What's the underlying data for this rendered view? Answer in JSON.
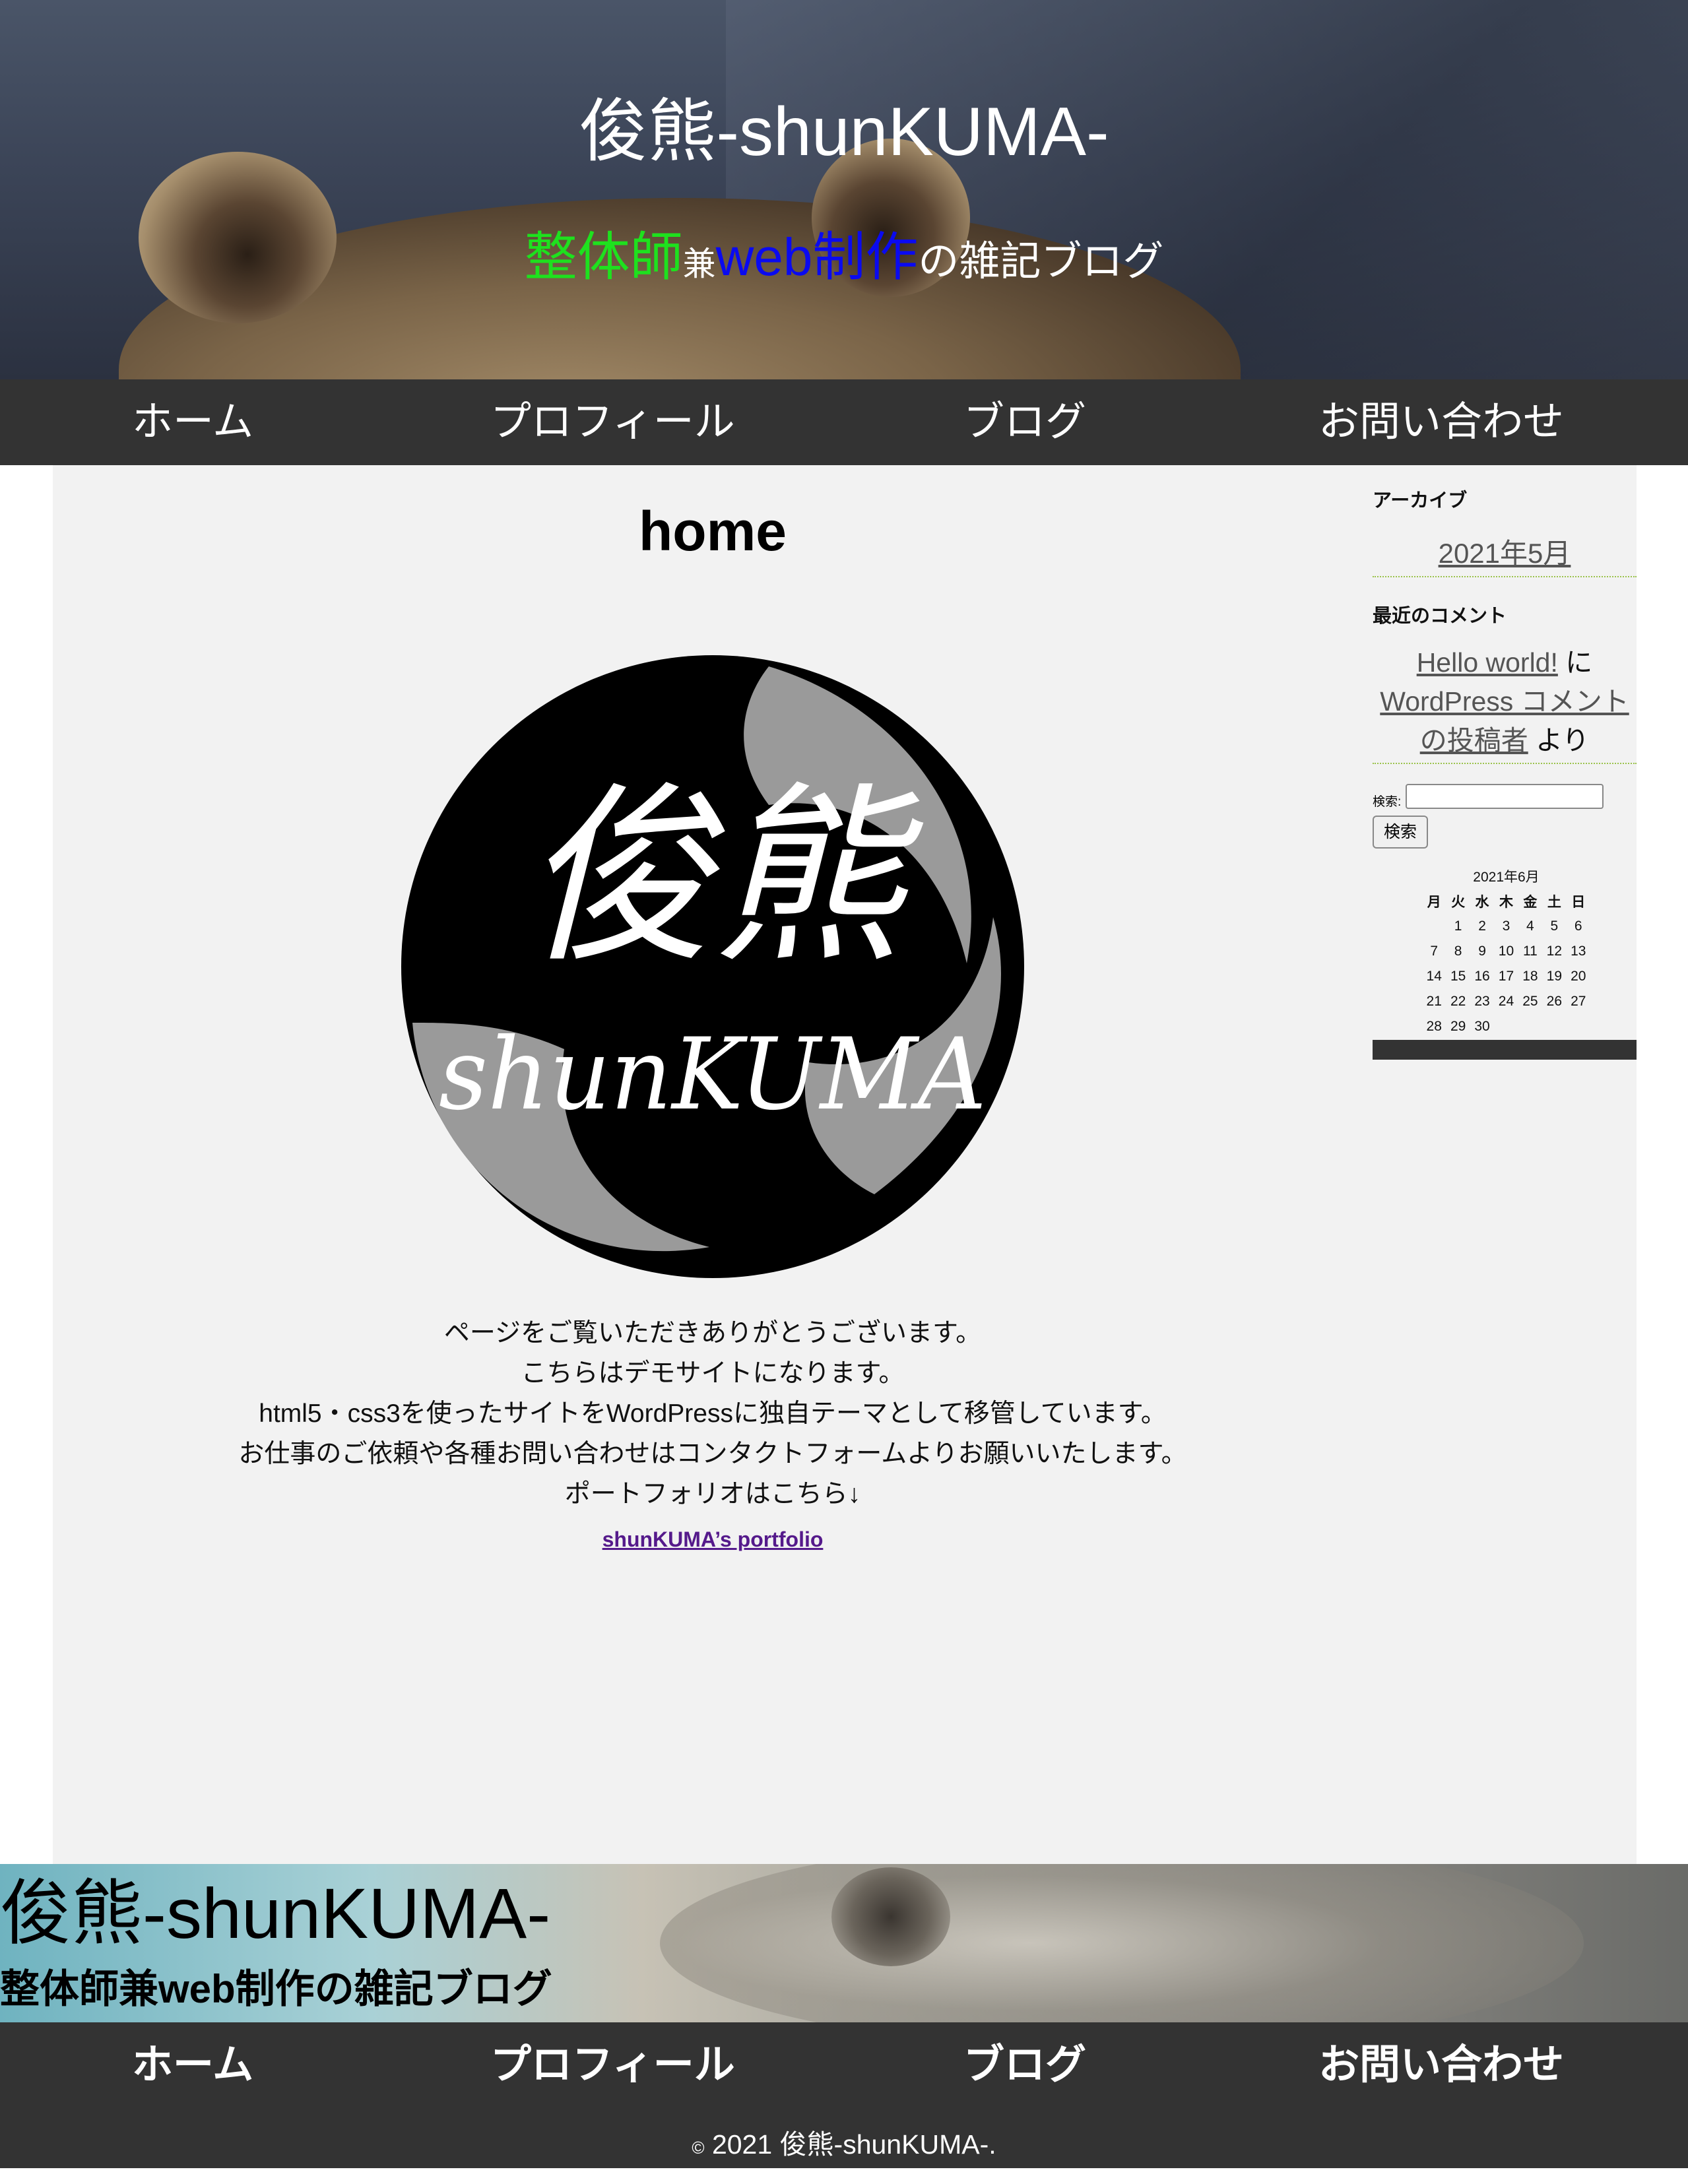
{
  "header": {
    "title": "俊熊-shunKUMA-",
    "subtitle": {
      "part1": "整体師",
      "part2": "兼",
      "part3": "web制作",
      "part4": "の雑記ブログ"
    }
  },
  "nav": {
    "items": [
      {
        "label": "ホーム"
      },
      {
        "label": "プロフィール"
      },
      {
        "label": "ブログ"
      },
      {
        "label": "お問い合わせ"
      }
    ]
  },
  "main": {
    "title": "home",
    "logo": {
      "kanji": "俊熊",
      "text": "shunKUMA"
    },
    "message": [
      "ページをご覧いただきありがとうございます。",
      "こちらはデモサイトになります。",
      "html5・css3を使ったサイトをWordPressに独自テーマとして移管しています。",
      "お仕事のご依頼や各種お問い合わせはコンタクトフォームよりお願いいたします。",
      "ポートフォリオはこちら↓"
    ],
    "portfolio_link": "shunKUMA’s portfolio"
  },
  "sidebar": {
    "archive": {
      "title": "アーカイブ",
      "link": "2021年5月"
    },
    "recent_comments": {
      "title": "最近のコメント",
      "post": "Hello world!",
      "ni": "に",
      "author": "WordPress コメントの投稿者",
      "yori": "より"
    },
    "search": {
      "label": "検索:",
      "button": "検索"
    },
    "calendar": {
      "caption": "2021年6月",
      "headers": [
        "月",
        "火",
        "水",
        "木",
        "金",
        "土",
        "日"
      ],
      "weeks": [
        [
          "",
          "1",
          "2",
          "3",
          "4",
          "5",
          "6"
        ],
        [
          "7",
          "8",
          "9",
          "10",
          "11",
          "12",
          "13"
        ],
        [
          "14",
          "15",
          "16",
          "17",
          "18",
          "19",
          "20"
        ],
        [
          "21",
          "22",
          "23",
          "24",
          "25",
          "26",
          "27"
        ],
        [
          "28",
          "29",
          "30",
          "",
          "",
          "",
          ""
        ]
      ]
    }
  },
  "footer": {
    "title": "俊熊-shunKUMA-",
    "subtitle": "整体師兼web制作の雑記ブログ",
    "nav": [
      {
        "label": "ホーム"
      },
      {
        "label": "プロフィール"
      },
      {
        "label": "ブログ"
      },
      {
        "label": "お問い合わせ"
      }
    ],
    "copyright_symbol": "©",
    "copyright_text": "2021 俊熊-shunKUMA-."
  }
}
